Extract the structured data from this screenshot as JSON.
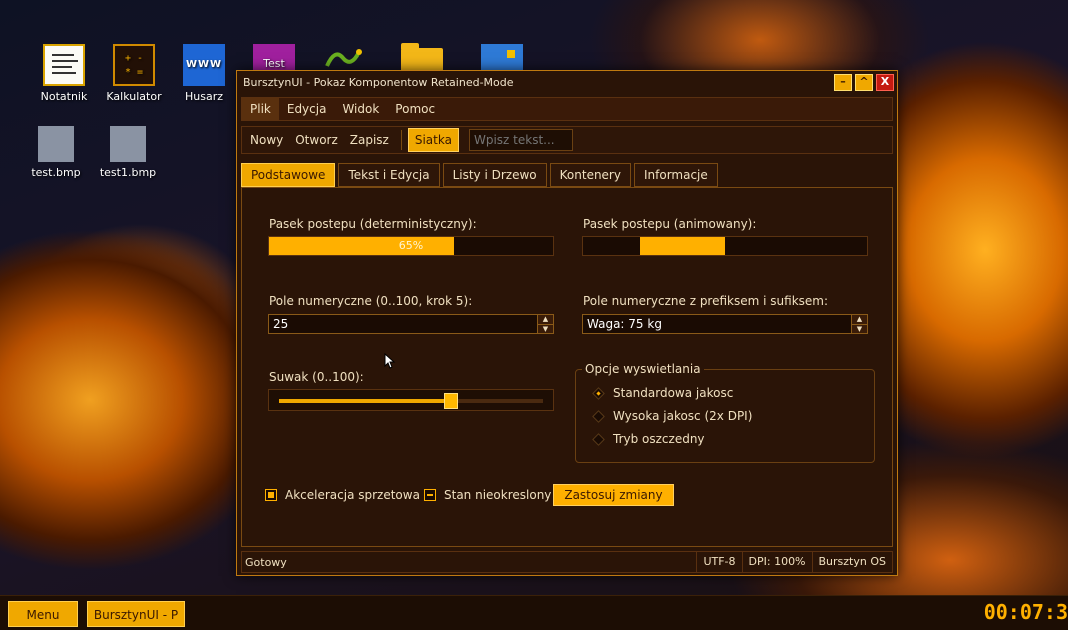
{
  "desktop": {
    "icons": [
      {
        "label": "Notatnik",
        "icon": "notepad-icon"
      },
      {
        "label": "Kalkulator",
        "icon": "calculator-icon",
        "glyph": "+ -\n* ="
      },
      {
        "label": "Husarz",
        "icon": "browser-icon",
        "glyph": "WWW"
      },
      {
        "label": "",
        "icon": "test-app-icon",
        "glyph": "Test"
      },
      {
        "label": "",
        "icon": "snake-icon"
      },
      {
        "label": "",
        "icon": "folder-icon"
      },
      {
        "label": "",
        "icon": "blue-app-icon"
      },
      {
        "label": "test.bmp",
        "icon": "image-file-icon"
      },
      {
        "label": "test1.bmp",
        "icon": "image-file-icon"
      }
    ]
  },
  "window": {
    "title": "BursztynUI - Pokaz Komponentow Retained-Mode",
    "minimize": "–",
    "maximize": "^",
    "close": "X"
  },
  "menubar": {
    "items": [
      "Plik",
      "Edycja",
      "Widok",
      "Pomoc"
    ],
    "active": "Plik"
  },
  "toolbar": {
    "buttons": [
      "Nowy",
      "Otworz",
      "Zapisz"
    ],
    "toggle": "Siatka",
    "input_placeholder": "Wpisz tekst..."
  },
  "tabs": {
    "items": [
      "Podstawowe",
      "Tekst i Edycja",
      "Listy i Drzewo",
      "Kontenery",
      "Informacje"
    ],
    "active": "Podstawowe"
  },
  "panel": {
    "progress_det": {
      "label": "Pasek postepu (deterministyczny):",
      "value": 0.65,
      "text": "65%"
    },
    "progress_anim": {
      "label": "Pasek postepu (animowany):",
      "segment_start": 0.2,
      "segment_end": 0.5
    },
    "spin1": {
      "label": "Pole numeryczne (0..100, krok 5):",
      "value": "25"
    },
    "spin2": {
      "label": "Pole numeryczne z prefiksem i sufiksem:",
      "value": "Waga: 75 kg"
    },
    "slider": {
      "label": "Suwak (0..100):",
      "value": 65
    },
    "display_options": {
      "title": "Opcje wyswietlania",
      "options": [
        "Standardowa jakosc",
        "Wysoka jakosc (2x DPI)",
        "Tryb oszczedny"
      ],
      "selected": 0
    },
    "checkbox1": {
      "label": "Akceleracja sprzetowa",
      "checked": true
    },
    "checkbox2": {
      "label": "Stan nieokreslony",
      "state": "indeterminate"
    },
    "apply_button": "Zastosuj zmiany"
  },
  "statusbar": {
    "status": "Gotowy",
    "encoding": "UTF-8",
    "dpi": "DPI: 100%",
    "os": "Bursztyn OS"
  },
  "taskbar": {
    "menu": "Menu",
    "task": "BursztynUI - P",
    "clock": "00:07:3"
  },
  "colors": {
    "accent": "#ffb000",
    "window_bg": "#2a1407",
    "border": "#7a4a12",
    "close": "#c41a10"
  }
}
